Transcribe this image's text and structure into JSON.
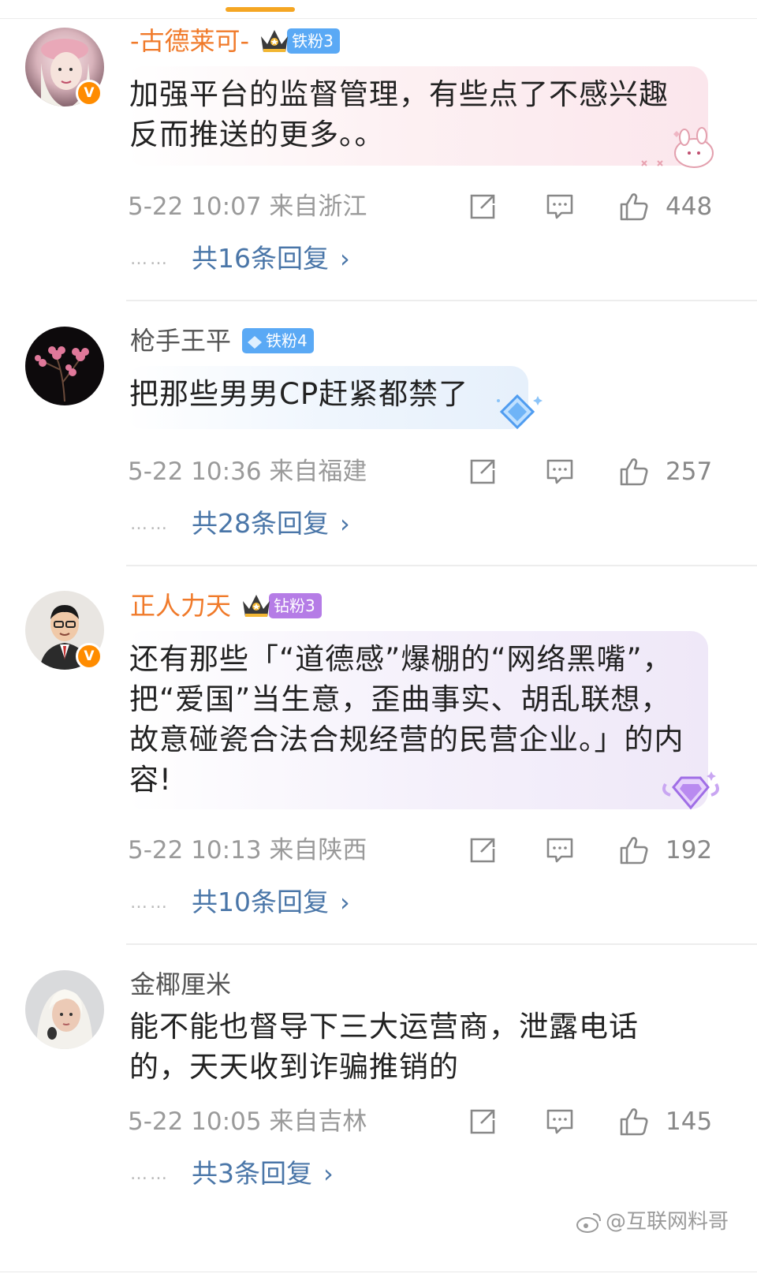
{
  "comments": [
    {
      "user": "-古德莱可-",
      "fan_badge": "铁粉3",
      "text": "加强平台的监督管理，有些点了不感兴趣反而推送的更多。。",
      "meta": "5-22 10:07  来自浙江",
      "likes": "448",
      "replies": "共16条回复"
    },
    {
      "user": "枪手王平",
      "fan_badge": "铁粉4",
      "text": "把那些男男CP赶紧都禁了",
      "meta": "5-22 10:36  来自福建",
      "likes": "257",
      "replies": "共28条回复"
    },
    {
      "user": "正人力天",
      "fan_badge": "钻粉3",
      "text": "还有那些「“道德感”爆棚的“网络黑嘴”，把“爱国”当生意，歪曲事实、胡乱联想，故意碰瓷合法合规经营的民营企业。」的内容!",
      "meta": "5-22 10:13  来自陕西",
      "likes": "192",
      "replies": "共10条回复"
    },
    {
      "user": "金椰厘米",
      "text": "能不能也督导下三大运营商，泄露电话的，天天收到诈骗推销的",
      "meta": "5-22 10:05  来自吉林",
      "likes": "145",
      "replies": "共3条回复"
    }
  ],
  "dots": "……",
  "chevron": "›",
  "verified_mark": "V",
  "watermark": "@互联网料哥",
  "colors": {
    "vip_name": "#f07a2a",
    "link": "#4a76a8",
    "meta": "#9a9a9a",
    "verified": "#ff8c00"
  },
  "icons": [
    "share-icon",
    "comment-icon",
    "like-icon",
    "crown-icon",
    "diamond-icon",
    "verified-icon"
  ]
}
